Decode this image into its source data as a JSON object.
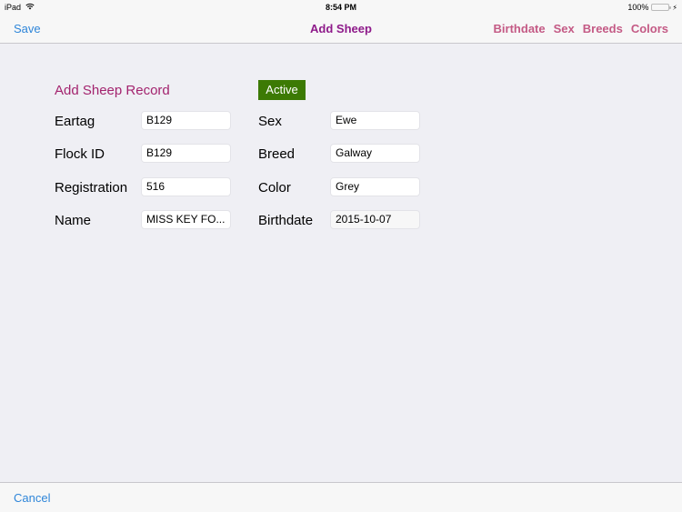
{
  "status_bar": {
    "device": "iPad",
    "time": "8:54 PM",
    "battery_percent": "100%",
    "battery_level": 1.0,
    "battery_color": "#4cd964"
  },
  "nav_bar": {
    "save_label": "Save",
    "title": "Add Sheep",
    "right_items": [
      "Birthdate",
      "Sex",
      "Breeds",
      "Colors"
    ]
  },
  "form": {
    "title": "Add Sheep Record",
    "status_badge": "Active",
    "status_color": "#3c7a04",
    "left_fields": [
      {
        "label": "Eartag",
        "value": "B129"
      },
      {
        "label": "Flock ID",
        "value": "B129"
      },
      {
        "label": "Registration",
        "value": "516"
      },
      {
        "label": "Name",
        "value": "MISS KEY FO..."
      }
    ],
    "right_fields": [
      {
        "label": "Sex",
        "value": "Ewe"
      },
      {
        "label": "Breed",
        "value": "Galway"
      },
      {
        "label": "Color",
        "value": "Grey"
      },
      {
        "label": "Birthdate",
        "value": "2015-10-07"
      }
    ]
  },
  "toolbar": {
    "cancel_label": "Cancel"
  },
  "colors": {
    "accent_blue": "#2f86d9",
    "title_purple": "#8e1a8a",
    "nav_pink": "#c45a85",
    "form_title": "#a3236e"
  }
}
